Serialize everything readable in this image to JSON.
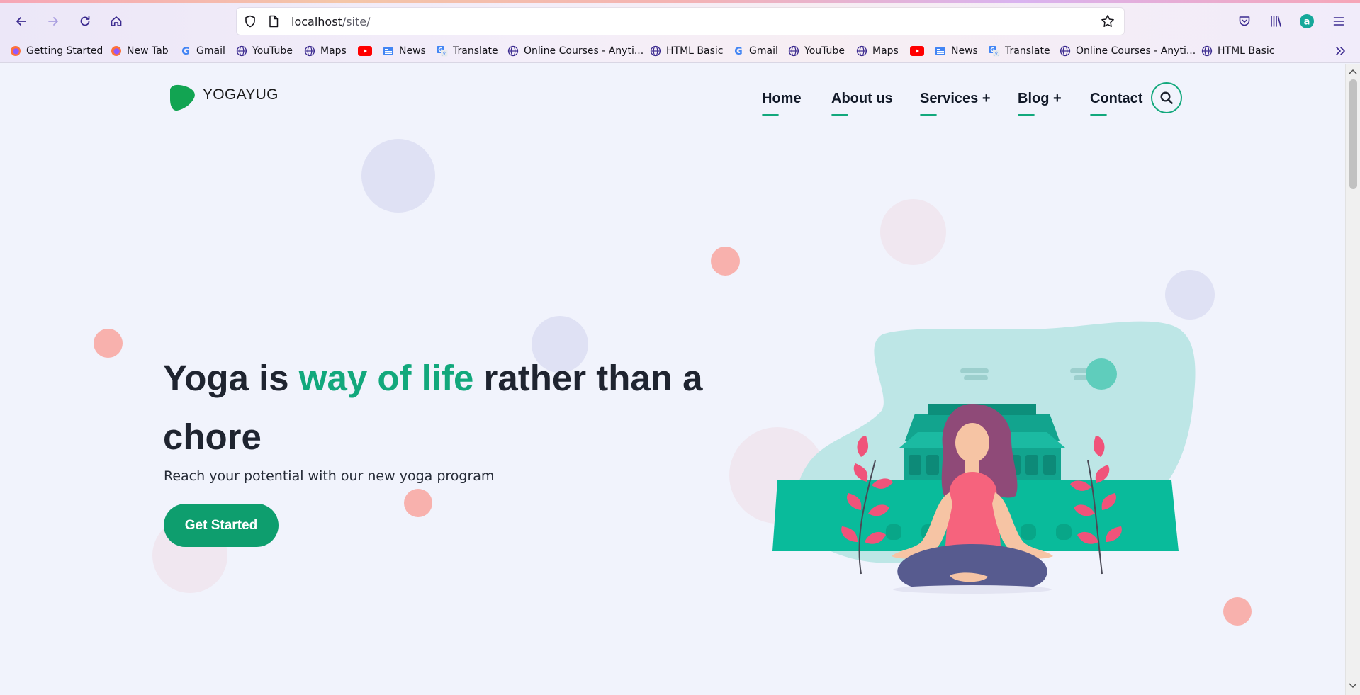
{
  "browser": {
    "url_host": "localhost",
    "url_path": "/site/",
    "bookmarks": [
      {
        "label": "Getting Started",
        "icon": "firefox-icon"
      },
      {
        "label": "New Tab",
        "icon": "firefox-icon"
      },
      {
        "label": "Gmail",
        "icon": "google-icon"
      },
      {
        "label": "YouTube",
        "icon": "globe-icon"
      },
      {
        "label": "Maps",
        "icon": "globe-icon"
      },
      {
        "label": "",
        "icon": "youtube-icon"
      },
      {
        "label": "News",
        "icon": "news-icon"
      },
      {
        "label": "Translate",
        "icon": "translate-icon"
      },
      {
        "label": "Online Courses - Anyti...",
        "icon": "globe-icon"
      },
      {
        "label": "HTML Basic",
        "icon": "globe-icon"
      },
      {
        "label": "Gmail",
        "icon": "google-icon"
      },
      {
        "label": "YouTube",
        "icon": "globe-icon"
      },
      {
        "label": "Maps",
        "icon": "globe-icon"
      },
      {
        "label": "",
        "icon": "youtube-icon"
      },
      {
        "label": "News",
        "icon": "news-icon"
      },
      {
        "label": "Translate",
        "icon": "translate-icon"
      },
      {
        "label": "Online Courses - Anyti...",
        "icon": "globe-icon"
      },
      {
        "label": "HTML Basic",
        "icon": "globe-icon"
      }
    ]
  },
  "site": {
    "logo_text": "YOGAYUG",
    "nav": [
      "Home",
      "About us",
      "Services +",
      "Blog +",
      "Contact"
    ],
    "hero": {
      "title_part1": "Yoga is ",
      "title_accent": "way of life",
      "title_part2": " rather than a chore",
      "subtitle": "Reach your potential with our new yoga program",
      "cta_label": "Get Started"
    }
  },
  "colors": {
    "accent": "#12a87c",
    "button": "#0e9e6e",
    "background": "#f1f3fc",
    "heading": "#1f2430"
  }
}
